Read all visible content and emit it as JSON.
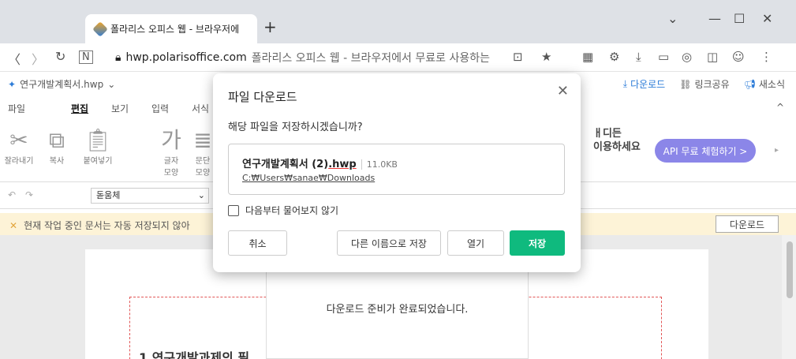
{
  "browser": {
    "tab_title": "폴라리스 오피스 웹 - 브라우저에",
    "new_tab": "+",
    "window_controls": [
      "⌄",
      "—",
      "☐",
      "✕"
    ],
    "url": "hwp.polarisoffice.com",
    "page_title_in_omnibox": "폴라리스 오피스 웹 - 브라우저에서 무료로 사용하는"
  },
  "app": {
    "doc_name": "연구개발계획서.hwp",
    "right_links": [
      "다운로드",
      "링크공유",
      "새소식"
    ],
    "menu": [
      "파일",
      "편집",
      "보기",
      "입력",
      "서식"
    ],
    "active_menu": "편집",
    "ribbon_buttons": [
      {
        "label": "잘라내기",
        "icon": "cut-icon"
      },
      {
        "label": "복사",
        "icon": "copy-icon"
      },
      {
        "label": "붙여넣기",
        "icon": "paste-icon"
      },
      {
        "label": "글자\n모양",
        "icon": "char-shape-icon"
      },
      {
        "label": "문단\n모양",
        "icon": "para-shape-icon"
      }
    ],
    "promo_text_line1": "ㅐ디든",
    "promo_text_line2": "이용하세요",
    "api_button": "API 무료 체험하기 >",
    "font_name": "돋움체",
    "warning_text": "현재 작업 중인 문서는 자동 저장되지 않아",
    "warning_download_button": "다운로드",
    "document_heading": "1   연구개발과제의 필"
  },
  "progress": {
    "message": "다운로드 준비가 완료되었습니다."
  },
  "dialog": {
    "title": "파일 다운로드",
    "question": "해당 파일을 저장하시겠습니까?",
    "file_base": "연구개발계획서 (2)",
    "file_ext": ".hwp",
    "file_size": "11.0KB",
    "file_path": "C:₩Users₩sanae₩Downloads",
    "checkbox_label": "다음부터 물어보지 않기",
    "buttons": {
      "cancel": "취소",
      "save_as": "다른 이름으로 저장",
      "open": "열기",
      "save": "저장"
    }
  },
  "colors": {
    "primary_save": "#0fba7e",
    "api_button": "#8b86e8",
    "warning_bg": "#fdf3d7"
  }
}
